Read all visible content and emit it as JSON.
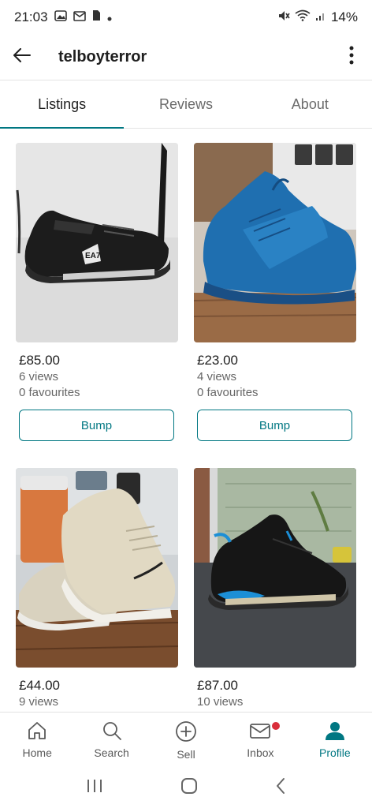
{
  "status_bar": {
    "time": "21:03",
    "battery": "14%",
    "icons": [
      "gallery-icon",
      "gmail-icon",
      "sim-icon",
      "dot-icon",
      "mute-icon",
      "wifi-icon",
      "signal-icon"
    ]
  },
  "header": {
    "title": "telboyterror",
    "back_icon": "back-arrow-icon",
    "more_icon": "more-vertical-icon"
  },
  "tabs": [
    {
      "label": "Listings",
      "active": true
    },
    {
      "label": "Reviews",
      "active": false
    },
    {
      "label": "About",
      "active": false
    }
  ],
  "listings": [
    {
      "price": "£85.00",
      "views": "6 views",
      "favourites": "0 favourites",
      "button": "Bump",
      "image": "black-ea7-sneaker"
    },
    {
      "price": "£23.00",
      "views": "4 views",
      "favourites": "0 favourites",
      "button": "Bump",
      "image": "blue-suede-hightop"
    },
    {
      "price": "£44.00",
      "views": "9 views",
      "image": "cream-nike-sneaker"
    },
    {
      "price": "£87.00",
      "views": "10 views",
      "image": "black-blue-jordan"
    }
  ],
  "bottom_nav": [
    {
      "label": "Home",
      "icon": "home-icon",
      "active": false
    },
    {
      "label": "Search",
      "icon": "search-icon",
      "active": false
    },
    {
      "label": "Sell",
      "icon": "plus-circle-icon",
      "active": false
    },
    {
      "label": "Inbox",
      "icon": "mail-icon",
      "active": false,
      "badge": true
    },
    {
      "label": "Profile",
      "icon": "profile-icon",
      "active": true
    }
  ],
  "colors": {
    "accent": "#007782",
    "badge": "#d92e3a"
  }
}
